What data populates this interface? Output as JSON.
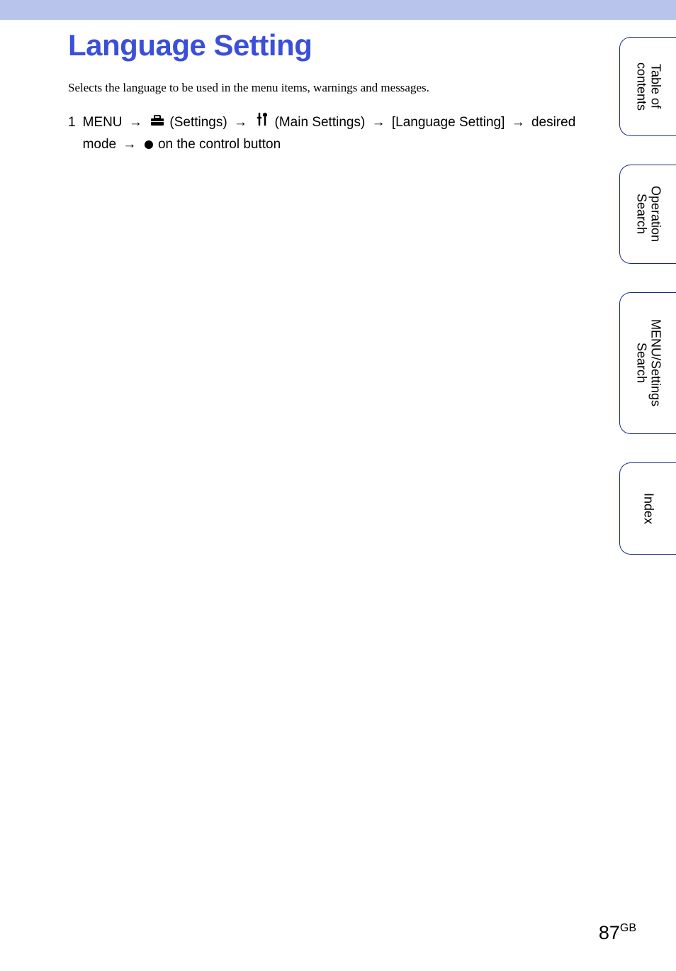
{
  "title": "Language Setting",
  "intro": "Selects the language to be used in the menu items, warnings and messages.",
  "step": {
    "number": "1",
    "menu": "MENU",
    "arrow": "→",
    "settings_label": "(Settings)",
    "main_settings_label": "(Main Settings)",
    "language_setting": "[Language Setting]",
    "desired_mode": "desired mode",
    "control_button": "on the control button"
  },
  "sidebar": {
    "tabs": [
      {
        "label": "Table of\ncontents"
      },
      {
        "label": "Operation\nSearch"
      },
      {
        "label": "MENU/Settings\nSearch"
      },
      {
        "label": "Index"
      }
    ]
  },
  "footer": {
    "page": "87",
    "region": "GB"
  }
}
